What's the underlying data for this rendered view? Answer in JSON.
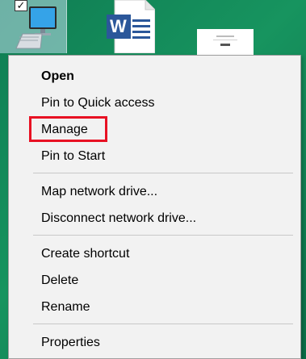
{
  "desktop": {
    "icons": [
      {
        "name": "This PC",
        "icon": "computer-icon",
        "selected": true,
        "checked": true
      },
      {
        "name": "Word document",
        "icon": "word-document-icon"
      },
      {
        "name": "Document thumbnail",
        "icon": "document-thumbnail-icon"
      }
    ],
    "checkbox_mark": "✓",
    "word_letter": "W"
  },
  "context_menu": {
    "items": [
      {
        "label": "Open",
        "bold": true
      },
      {
        "label": "Pin to Quick access"
      },
      {
        "label": "Manage",
        "highlighted": true
      },
      {
        "label": "Pin to Start"
      },
      {
        "label": "Map network drive..."
      },
      {
        "label": "Disconnect network drive..."
      },
      {
        "label": "Create shortcut"
      },
      {
        "label": "Delete"
      },
      {
        "label": "Rename"
      },
      {
        "label": "Properties"
      }
    ]
  },
  "colors": {
    "highlight_box": "#e81123",
    "menu_background": "#f2f2f2",
    "word_blue": "#2b579a"
  }
}
